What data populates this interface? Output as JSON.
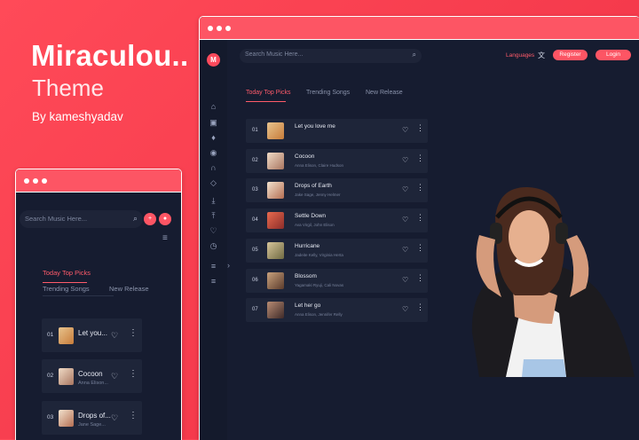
{
  "promo": {
    "title": "Miraculou..",
    "subtitle": "Theme",
    "author": "By kameshyadav"
  },
  "main": {
    "logo": "M",
    "search_placeholder": "Search Music Here...",
    "languages": "Languages",
    "register": "Register",
    "login": "Login",
    "tabs": [
      "Today Top Picks",
      "Trending Songs",
      "New Release"
    ],
    "rows": [
      {
        "num": "01",
        "title": "Let you love me",
        "artist": ""
      },
      {
        "num": "02",
        "title": "Cocoon",
        "artist": "Anna Elison, Claire Hudson"
      },
      {
        "num": "03",
        "title": "Drops of Earth",
        "artist": "Jake Sage, Jenny Helmer"
      },
      {
        "num": "04",
        "title": "Settle Down",
        "artist": "Ava Virgil, John Elison"
      },
      {
        "num": "05",
        "title": "Hurricane",
        "artist": "Jadeite Kelly, Virginia Herta"
      },
      {
        "num": "06",
        "title": "Blossom",
        "artist": "Yagamaki Ryuji, Cali Novas"
      },
      {
        "num": "07",
        "title": "Let her go",
        "artist": "Anna Elison, Jennifer Relly"
      }
    ],
    "sidebar_icons": [
      "home-icon",
      "album-icon",
      "mic-icon",
      "radio-icon",
      "headphones-icon",
      "diamond-icon",
      "download-icon",
      "upload-icon",
      "heart-icon",
      "history-icon",
      "playlist-icon",
      "add-playlist-icon"
    ]
  },
  "small": {
    "search_placeholder": "Search Music Here...",
    "tabs": [
      "Today Top Picks",
      "Trending Songs",
      "New Release"
    ],
    "rows": [
      {
        "num": "01",
        "title": "Let you...",
        "artist": ""
      },
      {
        "num": "02",
        "title": "Cocoon",
        "artist": "Anna Elison..."
      },
      {
        "num": "03",
        "title": "Drops of...",
        "artist": "Jane Sage..."
      }
    ]
  },
  "colors": {
    "accent": "#fd5564",
    "panel": "#161c30",
    "row": "#1e2539"
  }
}
